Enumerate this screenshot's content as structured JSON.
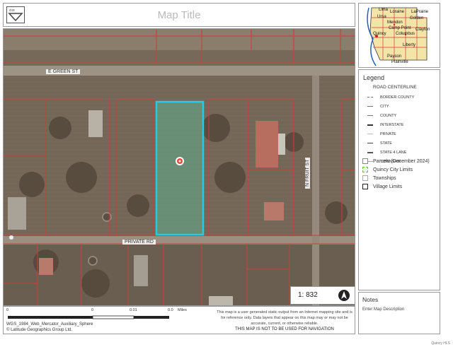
{
  "header": {
    "map_title": "Map Title"
  },
  "map": {
    "streets": {
      "e_green": "E GREEN ST",
      "private_rd": "PRIVATE RD",
      "n_fruit": "N FRUIT ST"
    },
    "scale_ratio": "1: 832"
  },
  "scalebar": {
    "tick_0": "0",
    "tick_a": "0",
    "tick_b": "0.01",
    "tick_c": "0.0",
    "units": "Miles"
  },
  "footer": {
    "projection": "WGS_1984_Web_Mercator_Auxiliary_Sphere",
    "copyright": "© Latitude Geographics Group Ltd.",
    "disclaimer": "This map is a user generated static output from an Internet mapping site and is for reference only. Data layers that appear on this map may or may not be accurate, current, or otherwise reliable.",
    "disclaimer_strong": "THIS MAP IS NOT TO BE USED FOR NAVIGATION"
  },
  "inset_map": {
    "places": [
      "Lima",
      "Loraine",
      "LaPrairie",
      "Ursa",
      "Golden",
      "Mendon",
      "Camp Point",
      "Clayton",
      "Quincy",
      "Columbus",
      "Liberty",
      "Payson",
      "Plainville"
    ]
  },
  "legend": {
    "title": "Legend",
    "road_header": "ROAD CENTERLINE",
    "road_items": [
      "BORDER COUNTY",
      "CITY",
      "COUNTY",
      "INTERSTATE",
      "PRIVATE",
      "STATE",
      "STATE 4 LANE",
      "TOWNSHIP"
    ],
    "layers": [
      "Parcels (December 2024)",
      "Quincy City Limits",
      "Townships",
      "Village Limits"
    ]
  },
  "notes": {
    "title": "Notes",
    "text": "Enter Map Description"
  },
  "credit": "Quincy HLS"
}
